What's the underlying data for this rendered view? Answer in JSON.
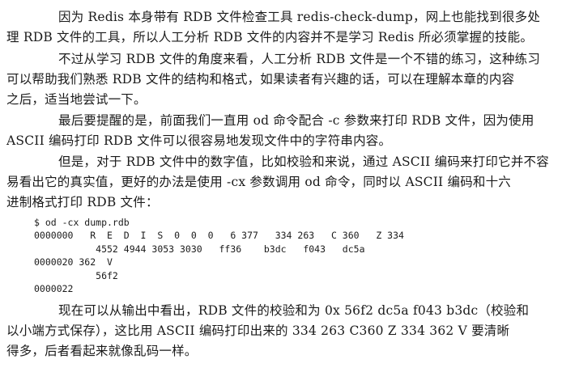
{
  "paragraphs": [
    {
      "lines": [
        "因为 Redis 本身带有 RDB 文件检查工具 redis-check-dump，网上也能找到很多处",
        "理 RDB 文件的工具，所以人工分析 RDB 文件的内容并不是学习 Redis 所必须掌握的技能。"
      ]
    },
    {
      "lines": [
        "不过从学习 RDB 文件的角度来看，人工分析 RDB 文件是一个不错的练习，这种练习",
        "可以帮助我们熟悉 RDB 文件的结构和格式，如果读者有兴趣的话，可以在理解本章的内容",
        "之后，适当地尝试一下。"
      ]
    },
    {
      "lines": [
        "最后要提醒的是，前面我们一直用 od 命令配合 -c 参数来打印 RDB 文件，因为使用",
        "ASCII 编码打印 RDB 文件可以很容易地发现文件中的字符串内容。"
      ]
    },
    {
      "lines": [
        "但是，对于 RDB 文件中的数字值，比如校验和来说，通过 ASCII 编码来打印它并不容",
        "易看出它的真实值，更好的办法是使用 -cx 参数调用 od 命令，同时以 ASCII 编码和十六",
        "进制格式打印 RDB 文件："
      ]
    },
    {
      "lines": [
        "现在可以从输出中看出，RDB 文件的校验和为 0x 56f2 dc5a f043 b3dc（校验和",
        "以小端方式保存），这比用 ASCII 编码打印出来的 334 263 C360 Z 334 362 V 要清晰",
        "得多，后者看起来就像乱码一样。"
      ]
    }
  ],
  "code_block": {
    "lines": [
      "$ od -cx dump.rdb",
      "0000000   R  E  D  I  S  0  0  0   6 377   334 263   C 360   Z 334",
      "           4552 4944 3053 3030   ff36    b3dc   f043   dc5a",
      "0000020 362  V",
      "           56f2",
      "0000022"
    ]
  }
}
